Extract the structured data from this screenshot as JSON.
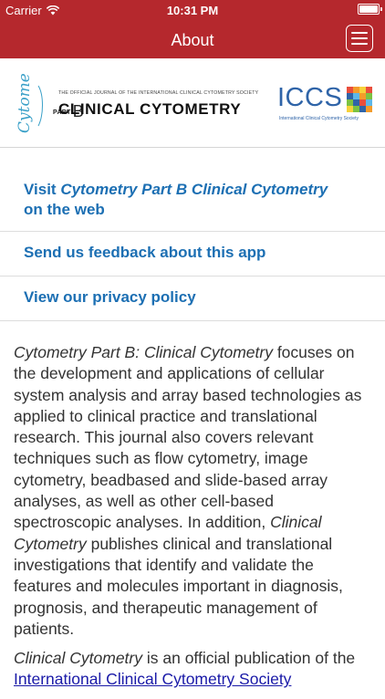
{
  "status_bar": {
    "carrier": "Carrier",
    "time": "10:31 PM",
    "battery_level": 1.0
  },
  "nav": {
    "title": "About",
    "menu_icon": "hamburger-menu-icon"
  },
  "banner": {
    "cytometry_script": "Cytometry",
    "part_label": "PART",
    "part_letter": "B",
    "society_line": "THE OFFICIAL JOURNAL OF THE INTERNATIONAL CLINICAL CYTOMETRY SOCIETY",
    "journal_title": "CLINICAL CYTOMETRY",
    "iccs_logo_text": "ICCS",
    "iccs_subtitle": "International Clinical Cytometry Society"
  },
  "links": {
    "visit_prefix": "Visit ",
    "visit_journal": "Cytometry Part B Clinical Cytometry",
    "visit_suffix": "on the web",
    "feedback": "Send us feedback about this app",
    "privacy": "View our privacy policy"
  },
  "about": {
    "p1_italic": "Cytometry Part B: Clinical Cytometry",
    "p1_text_a": " focuses on the development and applications of cellular system analysis and array based technologies as applied to clinical practice and translational research. This journal also covers relevant techniques such as flow cytometry, image cytometry, beadbased and slide-based array analyses, as well as other cell-based spectroscopic analyses. In addition, ",
    "p1_italic_2": "Clinical Cytometry",
    "p1_text_b": " publishes clinical and translational investigations that identify and validate the features and molecules important in diagnosis, prognosis, and therapeutic management of patients.",
    "p2_italic": "Clinical Cytometry",
    "p2_text": " is an official publication of the ",
    "p2_link": "International Clinical Cytometry Society"
  },
  "colors": {
    "nav_bar": "#b5282d",
    "link": "#1c6fb3",
    "body_text": "#333333",
    "iccs_blue": "#2f64a8"
  }
}
